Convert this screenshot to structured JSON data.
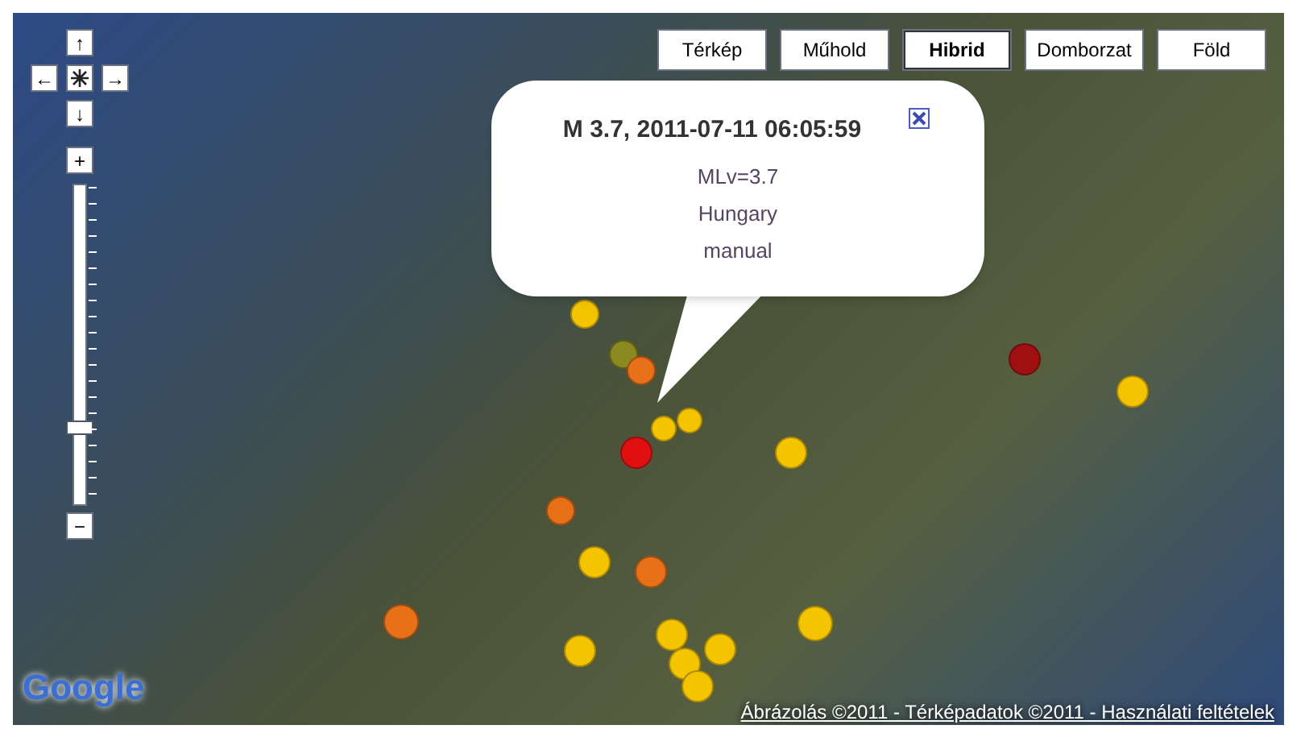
{
  "map_types": [
    {
      "label": "Térkép",
      "selected": false
    },
    {
      "label": "Műhold",
      "selected": false
    },
    {
      "label": "Hibrid",
      "selected": true
    },
    {
      "label": "Domborzat",
      "selected": false
    },
    {
      "label": "Föld",
      "selected": false
    }
  ],
  "pan_controls": {
    "up": "↑",
    "left": "←",
    "right": "→",
    "down": "↓"
  },
  "zoom": {
    "in": "+",
    "out": "−",
    "level": 0.23
  },
  "info_window": {
    "title": "M 3.7, 2011-07-11 06:05:59",
    "lines": [
      "MLv=3.7",
      "Hungary",
      "manual"
    ]
  },
  "markers": [
    {
      "color": "#f5c400"
    },
    {
      "color": "#8a8a20"
    },
    {
      "color": "#e87018"
    },
    {
      "color": "#a01010"
    },
    {
      "color": "#f5c400"
    },
    {
      "color": "#f5c400"
    },
    {
      "color": "#f5c400"
    },
    {
      "color": "#e01010"
    },
    {
      "color": "#f5c400"
    },
    {
      "color": "#e87018"
    },
    {
      "color": "#f5c400"
    },
    {
      "color": "#e87018"
    },
    {
      "color": "#e87018"
    },
    {
      "color": "#f5c400"
    },
    {
      "color": "#f5c400"
    },
    {
      "color": "#f5c400"
    },
    {
      "color": "#f5c400"
    },
    {
      "color": "#f5c400"
    },
    {
      "color": "#f5c400"
    }
  ],
  "logo": "Google",
  "copyright": "Ábrázolás ©2011 - Térképadatok ©2011 - Használati feltételek"
}
